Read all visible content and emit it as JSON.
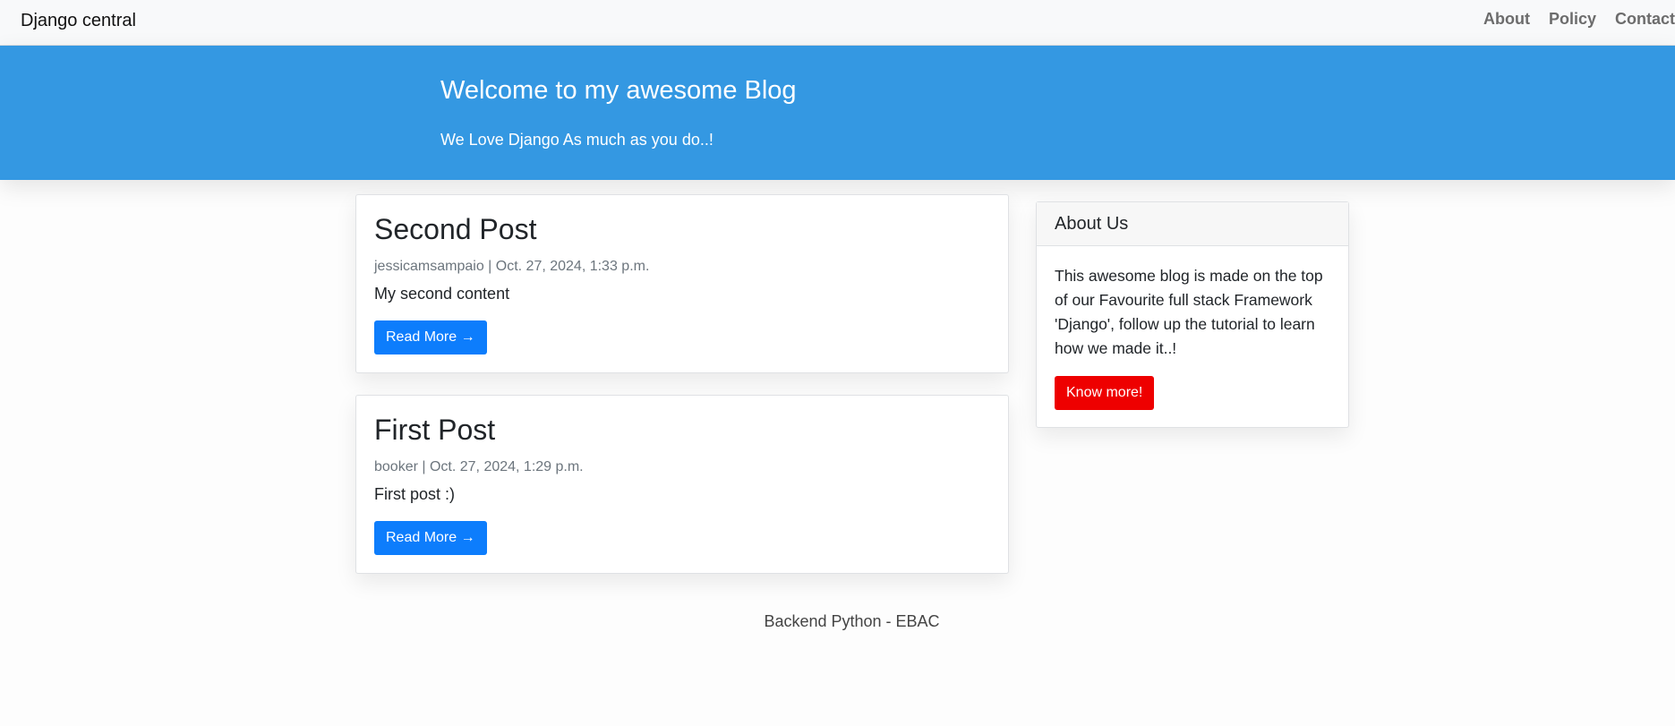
{
  "navbar": {
    "brand": "Django central",
    "links": [
      "About",
      "Policy",
      "Contact"
    ]
  },
  "masthead": {
    "title": "Welcome to my awesome Blog",
    "subtitle": "We Love Django As much as you do..!"
  },
  "posts": [
    {
      "title": "Second Post",
      "meta": "jessicamsampaio | Oct. 27, 2024, 1:33 p.m.",
      "content": "My second content",
      "button": "Read More →"
    },
    {
      "title": "First Post",
      "meta": "booker | Oct. 27, 2024, 1:29 p.m.",
      "content": "First post :)",
      "button": "Read More →"
    }
  ],
  "sidebar": {
    "title": "About Us",
    "text": "This awesome blog is made on the top of our Favourite full stack Framework 'Django', follow up the tutorial to learn how we made it..!",
    "button": "Know more!"
  },
  "footer": {
    "text": "Backend Python - EBAC"
  },
  "colors": {
    "masthead": "#3498e2",
    "primary_button": "#0d7dfc",
    "danger_button": "#ee0000",
    "navbar": "#f8f9fa"
  }
}
